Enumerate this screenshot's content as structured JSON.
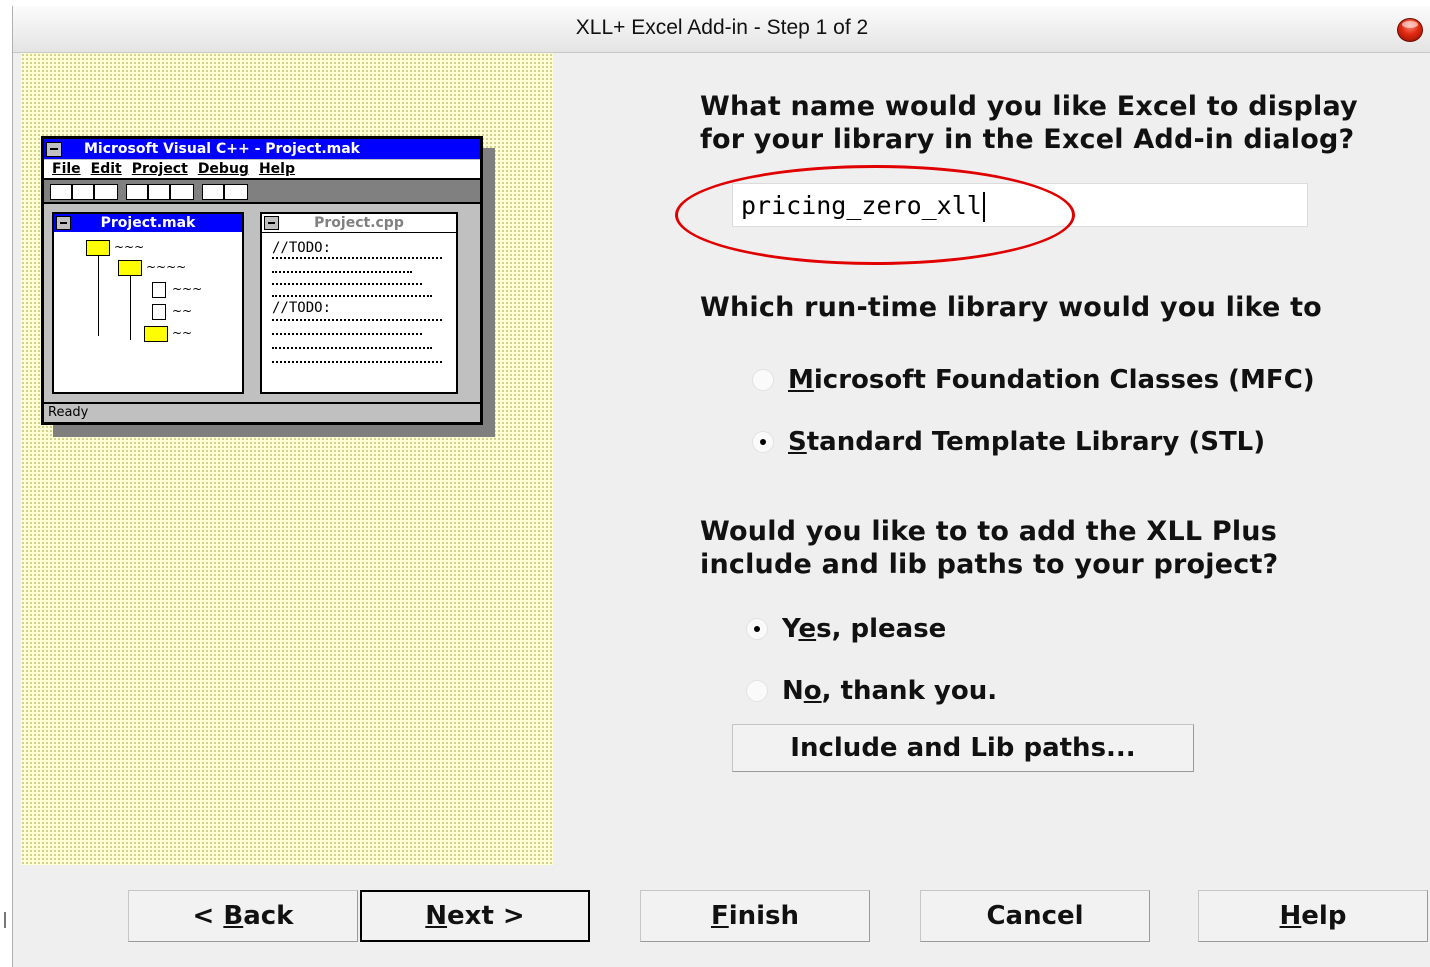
{
  "window": {
    "title": "XLL+ Excel Add-in - Step 1 of 2"
  },
  "illustration": {
    "title": "Microsoft Visual C++ - Project.mak",
    "menu": [
      "File",
      "Edit",
      "Project",
      "Debug",
      "Help"
    ],
    "project_pane_title": "Project.mak",
    "code_pane_title": "Project.cpp",
    "code_todo_1": "//TODO:",
    "code_todo_2": "//TODO:",
    "status": "Ready"
  },
  "questions": {
    "display_name_line1": "What name would you like Excel to display",
    "display_name_line2": "for your library in the Excel Add-in dialog?",
    "runtime_line1": "Which run-time library would you like to",
    "paths_line1": "Would you like to to add the XLL Plus",
    "paths_line2": "include and lib paths to your project?"
  },
  "name_field": {
    "value": "pricing_zero_xll"
  },
  "runtime_options": {
    "mfc": {
      "pre": "",
      "key": "M",
      "post": "icrosoft Foundation Classes (MFC)",
      "checked": false
    },
    "stl": {
      "pre": "",
      "key": "S",
      "post": "tandard Template Library (STL)",
      "checked": true
    }
  },
  "path_options": {
    "yes": {
      "pre": "Y",
      "key": "e",
      "post": "s, please",
      "checked": true
    },
    "no": {
      "pre": "N",
      "key": "o",
      "post": ", thank you.",
      "checked": false
    }
  },
  "buttons": {
    "paths": "Include and Lib paths...",
    "back": {
      "pre": "< ",
      "key": "B",
      "post": "ack"
    },
    "next": {
      "pre": "",
      "key": "N",
      "post": "ext >"
    },
    "finish": {
      "pre": "",
      "key": "F",
      "post": "inish"
    },
    "cancel": "Cancel",
    "help": {
      "pre": "",
      "key": "H",
      "post": "elp"
    }
  },
  "colors": {
    "highlight_ellipse": "#e00000",
    "sidebar_bg": "#ffffd6",
    "mini_title_bg": "#0000ff"
  }
}
